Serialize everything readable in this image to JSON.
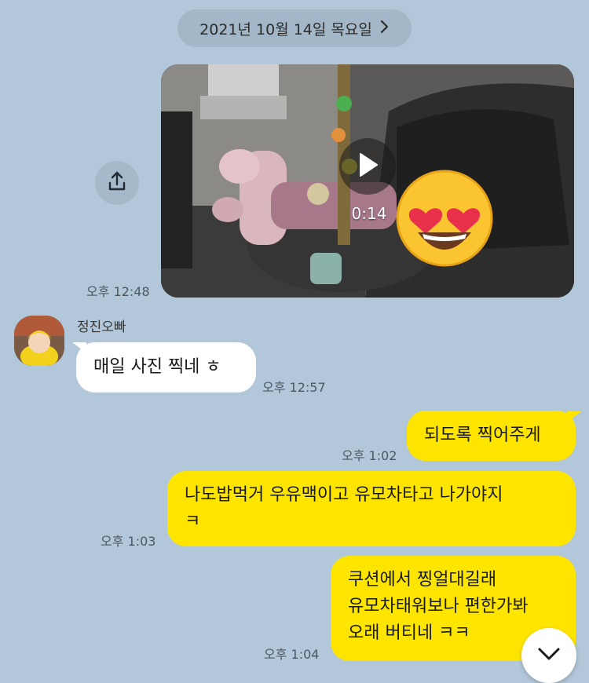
{
  "date_divider": {
    "label": "2021년 10월 14일 목요일",
    "chevron_icon": "chevron-right-icon"
  },
  "video_message": {
    "duration": "0:14",
    "time": "오후 12:48",
    "share_icon": "share-icon",
    "play_icon": "play-icon",
    "overlay_emoji": "heart-eyes-emoji"
  },
  "incoming": {
    "sender_name": "정진오빠",
    "text": "매일 사진 찍네 ㅎ",
    "time": "오후 12:57"
  },
  "outgoing": [
    {
      "lines": [
        "되도록 찍어주게"
      ],
      "time": "오후 1:02"
    },
    {
      "lines": [
        "나도밥먹거 우유맥이고 유모차타고 나가야지",
        "ㅋ"
      ],
      "time": "오후 1:03"
    },
    {
      "lines": [
        "쿠션에서 찡얼대길래",
        "유모차태워보나 편한가봐",
        "오래 버티네 ㅋㅋ"
      ],
      "time": "오후 1:04"
    }
  ],
  "scroll_down_icon": "chevron-down-icon",
  "colors": {
    "background": "#b2c7d9",
    "outgoing_bubble": "#fee500",
    "incoming_bubble": "#ffffff"
  }
}
